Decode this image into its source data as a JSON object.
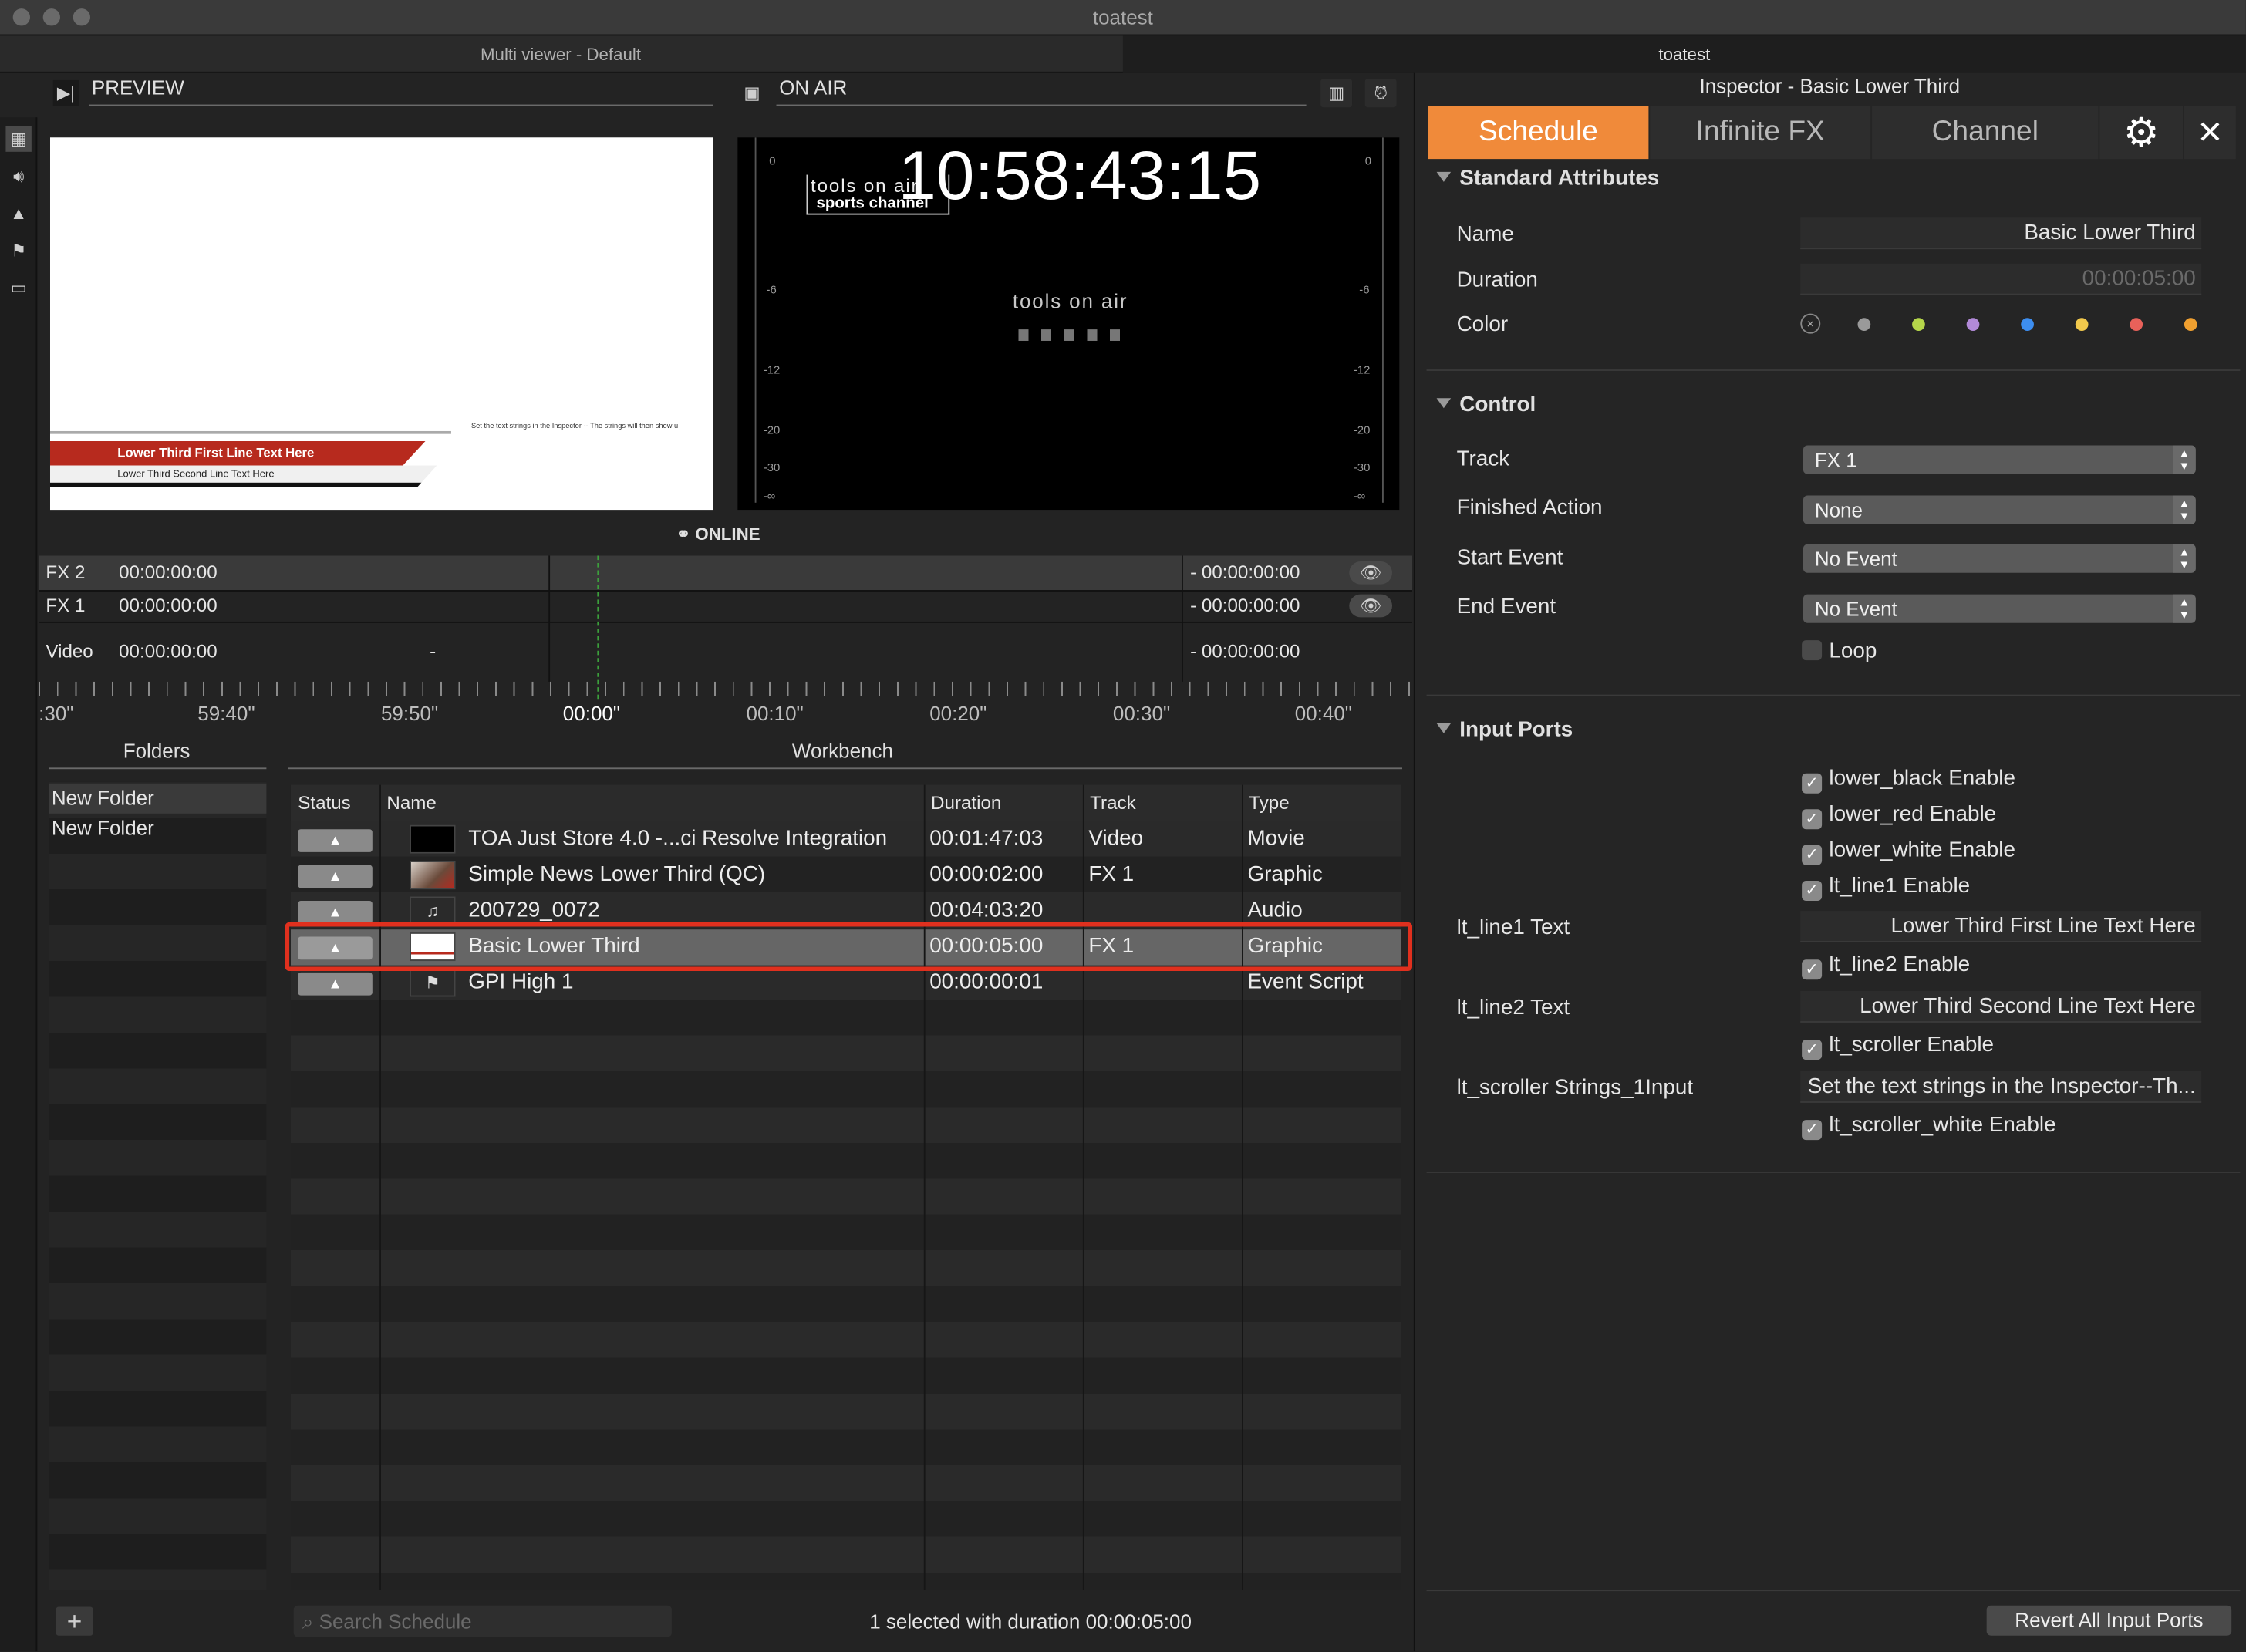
{
  "window": {
    "title": "toatest",
    "tabs": [
      "Multi viewer - Default",
      "toatest"
    ]
  },
  "preview": {
    "title": "PREVIEW",
    "lt_line1": "Lower Third First Line Text Here",
    "lt_line2": "Lower Third Second Line Text Here",
    "scroller": "Set the text strings in the Inspector -- The strings will then show u"
  },
  "onair": {
    "title": "ON AIR",
    "timecode": "10:58:43:15",
    "status": "ONLINE",
    "logo_text": "tools on air",
    "logo_line2": "sports channel",
    "vu_labels": [
      "0",
      "-6",
      "-12",
      "-20",
      "-30",
      "-∞"
    ]
  },
  "timeline": {
    "rows": [
      {
        "track": "FX 2",
        "start": "00:00:00:00",
        "mid": "",
        "end": "- 00:00:00:00"
      },
      {
        "track": "FX 1",
        "start": "00:00:00:00",
        "mid": "",
        "end": "- 00:00:00:00"
      },
      {
        "track": "Video",
        "start": "00:00:00:00",
        "mid": "-",
        "end": "- 00:00:00:00"
      }
    ],
    "ruler": [
      ":30\"",
      "59:40\"",
      "59:50\"",
      "00:00\"",
      "00:10\"",
      "00:20\"",
      "00:30\"",
      "00:40\""
    ]
  },
  "folders": {
    "title": "Folders",
    "items": [
      "New Folder",
      "New Folder"
    ]
  },
  "workbench": {
    "title": "Workbench",
    "columns": [
      "Status",
      "Name",
      "Duration",
      "Track",
      "Type"
    ],
    "rows": [
      {
        "name": "TOA Just Store 4.0 -...ci Resolve Integration",
        "duration": "00:01:47:03",
        "track": "Video",
        "type": "Movie"
      },
      {
        "name": "Simple News Lower Third (QC)",
        "duration": "00:00:02:00",
        "track": "FX 1",
        "type": "Graphic"
      },
      {
        "name": "200729_0072",
        "duration": "00:04:03:20",
        "track": "",
        "type": "Audio"
      },
      {
        "name": "Basic Lower Third",
        "duration": "00:00:05:00",
        "track": "FX 1",
        "type": "Graphic"
      },
      {
        "name": "GPI High 1",
        "duration": "00:00:00:01",
        "track": "",
        "type": "Event Script"
      }
    ],
    "status_glyph": "▲",
    "search_placeholder": "Search Schedule",
    "summary": "1 selected with duration 00:00:05:00"
  },
  "inspector": {
    "title": "Inspector - Basic Lower Third",
    "tabs": [
      "Schedule",
      "Infinite FX",
      "Channel"
    ],
    "standard": {
      "header": "Standard Attributes",
      "name_label": "Name",
      "name_value": "Basic Lower Third",
      "duration_label": "Duration",
      "duration_value": "00:00:05:00",
      "color_label": "Color"
    },
    "colors": [
      "#9a9a9a",
      "#b5d64a",
      "#b28ad8",
      "#3d8ef0",
      "#f2c94c",
      "#e8615a",
      "#f0a030"
    ],
    "control": {
      "header": "Control",
      "track_label": "Track",
      "track_value": "FX 1",
      "finished_label": "Finished Action",
      "finished_value": "None",
      "start_label": "Start Event",
      "start_value": "No Event",
      "end_label": "End Event",
      "end_value": "No Event",
      "loop_label": "Loop"
    },
    "ports": {
      "header": "Input Ports",
      "lower_black": "lower_black Enable",
      "lower_red": "lower_red Enable",
      "lower_white": "lower_white Enable",
      "lt_line1_enable": "lt_line1 Enable",
      "lt_line1_label": "lt_line1 Text",
      "lt_line1_value": "Lower Third First Line Text Here",
      "lt_line2_enable": "lt_line2 Enable",
      "lt_line2_label": "lt_line2 Text",
      "lt_line2_value": "Lower Third Second Line Text Here",
      "scroller_enable": "lt_scroller Enable",
      "scroller_label": "lt_scroller Strings_1Input",
      "scroller_value": "Set the text strings in the Inspector--Th...",
      "scroller_white": "lt_scroller_white Enable"
    },
    "revert_button": "Revert All Input Ports"
  }
}
